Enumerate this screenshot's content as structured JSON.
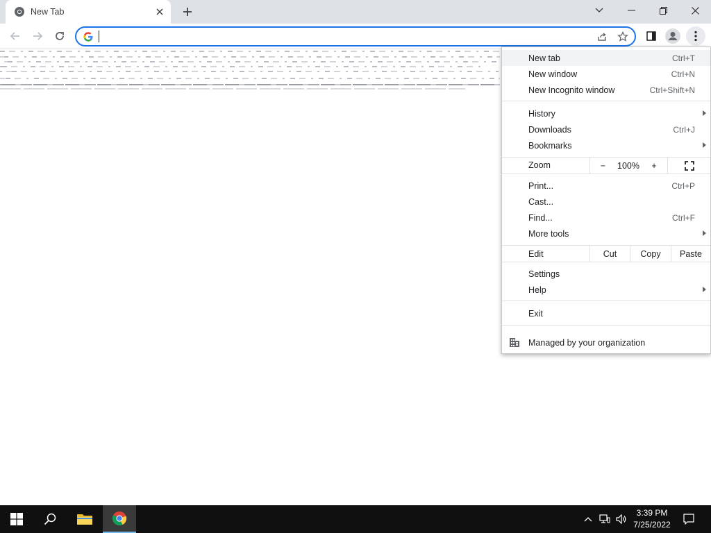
{
  "browser": {
    "tab": {
      "title": "New Tab"
    },
    "omnibox": {
      "value": "",
      "placeholder": ""
    }
  },
  "menu": {
    "items": {
      "new_tab": {
        "label": "New tab",
        "shortcut": "Ctrl+T"
      },
      "new_window": {
        "label": "New window",
        "shortcut": "Ctrl+N"
      },
      "new_incognito": {
        "label": "New Incognito window",
        "shortcut": "Ctrl+Shift+N"
      },
      "history": {
        "label": "History"
      },
      "downloads": {
        "label": "Downloads",
        "shortcut": "Ctrl+J"
      },
      "bookmarks": {
        "label": "Bookmarks"
      },
      "print": {
        "label": "Print...",
        "shortcut": "Ctrl+P"
      },
      "cast": {
        "label": "Cast..."
      },
      "find": {
        "label": "Find...",
        "shortcut": "Ctrl+F"
      },
      "more_tools": {
        "label": "More tools"
      },
      "settings": {
        "label": "Settings"
      },
      "help": {
        "label": "Help"
      },
      "exit": {
        "label": "Exit"
      }
    },
    "zoom": {
      "label": "Zoom",
      "minus": "−",
      "level": "100%",
      "plus": "+"
    },
    "edit": {
      "label": "Edit",
      "cut": "Cut",
      "copy": "Copy",
      "paste": "Paste"
    },
    "managed": {
      "label": "Managed by your organization"
    }
  },
  "taskbar": {
    "time": "3:39 PM",
    "date": "7/25/2022"
  },
  "colors": {
    "accent": "#1a73e8",
    "tabstrip": "#dee1e6",
    "taskbar": "#101010"
  }
}
